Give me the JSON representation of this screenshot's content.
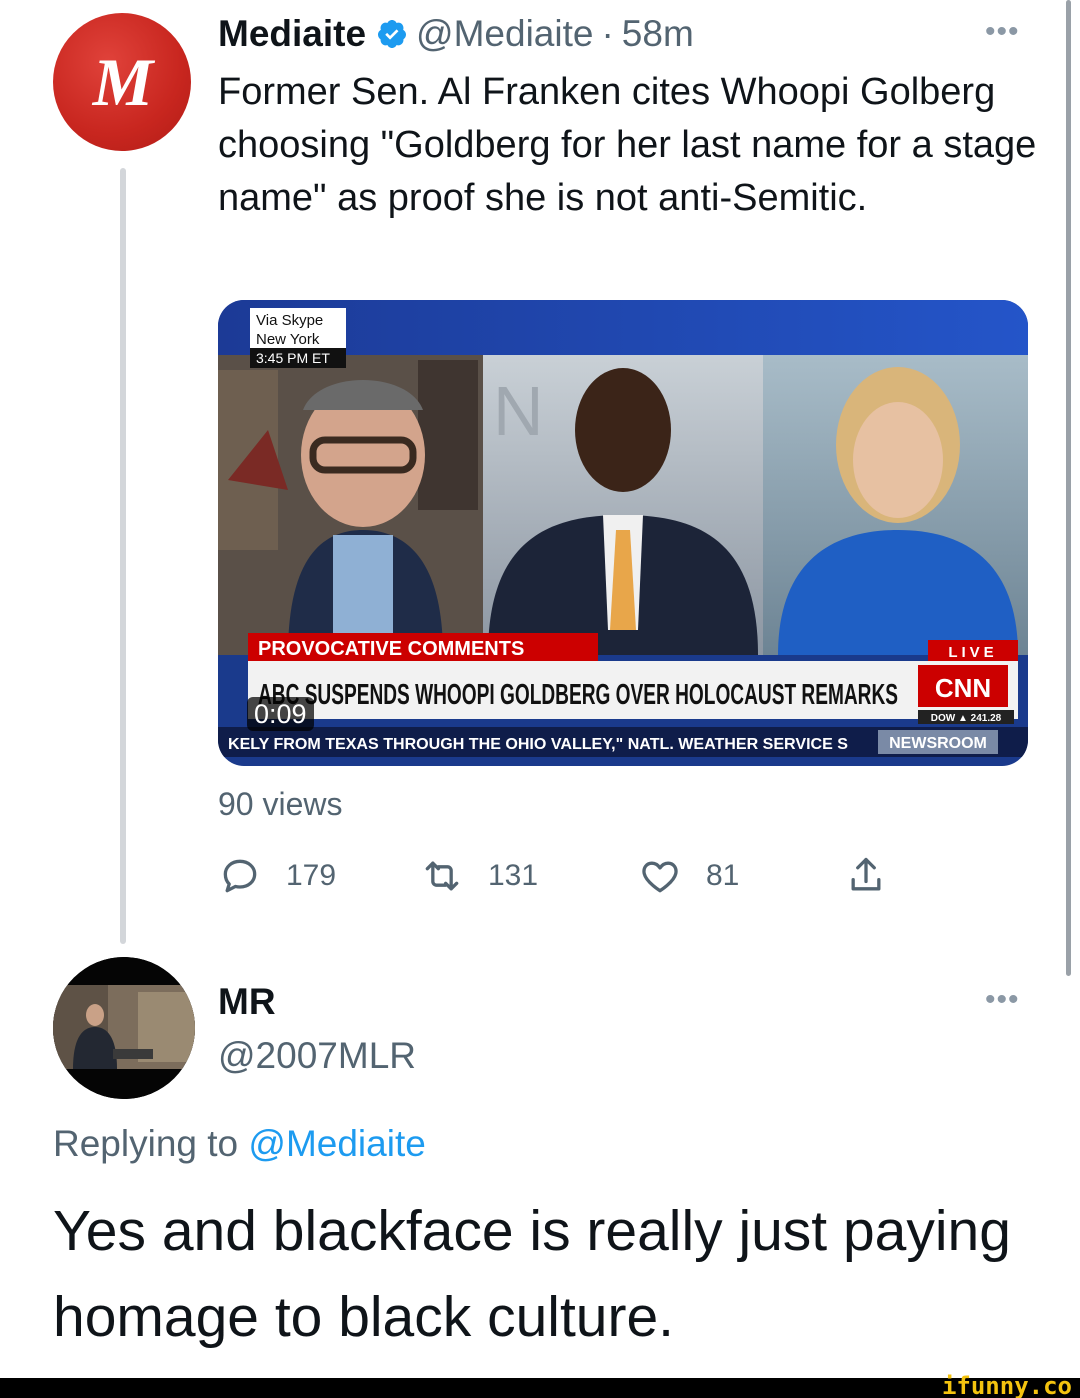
{
  "tweet1": {
    "avatar_letter": "M",
    "display_name": "Mediaite",
    "handle": "@Mediaite",
    "separator": "·",
    "time": "58m",
    "more_label": "•••",
    "text": "Former Sen. Al Franken cites Whoopi Golberg choosing \"Goldberg for her last name for a stage name\" as proof she is not anti-Semitic.",
    "media": {
      "skype_via": "Via Skype",
      "skype_city": "New York",
      "skype_time": "3:45 PM ET",
      "banner_label": "PROVOCATIVE COMMENTS",
      "headline": "ABC SUSPENDS WHOOPI GOLDBERG OVER HOLOCAUST REMARKS",
      "live_label": "LIVE",
      "network_logo": "CNN",
      "dow_label": "DOW ▲ 241.28",
      "ticker": "KELY FROM TEXAS THROUGH THE OHIO VALLEY,\" NATL. WEATHER SERVICE S",
      "newsroom": "NEWSROOM",
      "timer": "0:09"
    },
    "views": "90 views",
    "actions": {
      "replies": "179",
      "retweets": "131",
      "likes": "81"
    }
  },
  "tweet2": {
    "display_name": "MR",
    "handle": "@2007MLR",
    "more_label": "•••",
    "replying_prefix": "Replying to",
    "replying_mention": "@Mediaite",
    "text": "Yes and blackface is really just paying homage to black culture."
  },
  "watermark": "ifunny.co",
  "colors": {
    "mediaite_red": "#c8261f",
    "verified_blue": "#1d9bf0",
    "muted_text": "#536471",
    "cnn_red": "#cc0000",
    "watermark_yellow": "#f4c30f"
  }
}
